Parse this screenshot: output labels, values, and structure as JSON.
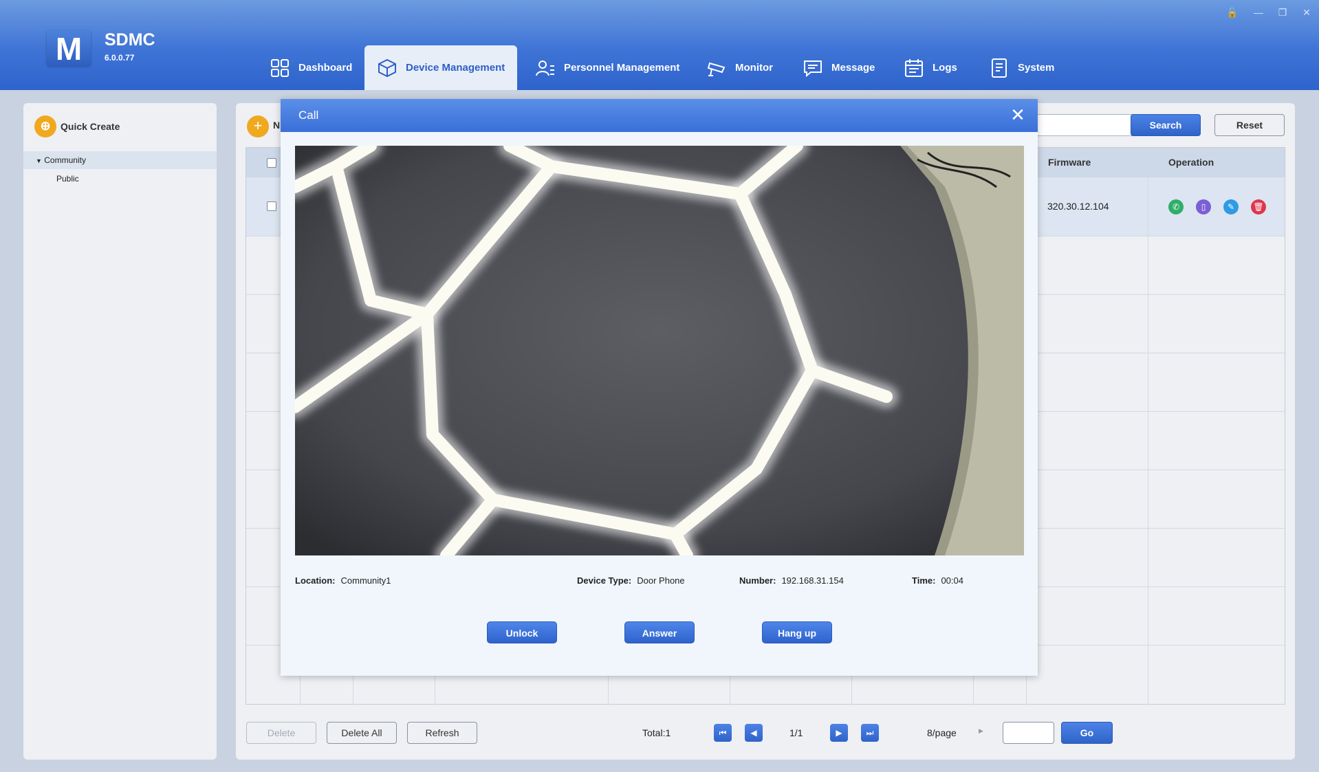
{
  "app": {
    "logo_letter": "M",
    "name": "SDMC",
    "version": "6.0.0.77"
  },
  "window_controls": {
    "lock": "🔓",
    "minimize": "—",
    "restore": "❐",
    "close": "✕"
  },
  "nav": [
    {
      "label": "Dashboard",
      "icon": "dashboard-icon"
    },
    {
      "label": "Device Management",
      "icon": "device-icon",
      "active": true
    },
    {
      "label": "Personnel Management",
      "icon": "personnel-icon"
    },
    {
      "label": "Monitor",
      "icon": "camera-icon"
    },
    {
      "label": "Message",
      "icon": "message-icon"
    },
    {
      "label": "Logs",
      "icon": "calendar-icon"
    },
    {
      "label": "System",
      "icon": "document-icon"
    }
  ],
  "sidebar": {
    "quick_create": "Quick Create",
    "tree": [
      {
        "label": "Community",
        "expanded": true
      },
      {
        "label": "Public"
      }
    ]
  },
  "main": {
    "add_label": "N",
    "search_label": "Search",
    "reset_label": "Reset",
    "columns": {
      "firmware": "Firmware",
      "operation": "Operation"
    },
    "row": {
      "firmware": "320.30.12.104"
    },
    "footer": {
      "delete": "Delete",
      "delete_all": "Delete All",
      "refresh": "Refresh",
      "total": "Total:1",
      "page": "1/1",
      "per_page": "8/page",
      "go": "Go"
    }
  },
  "dialog": {
    "title": "Call",
    "location_label": "Location:",
    "location": "Community1",
    "device_type_label": "Device Type:",
    "device_type": "Door Phone",
    "number_label": "Number:",
    "number": "192.168.31.154",
    "time_label": "Time:",
    "time": "00:04",
    "buttons": {
      "unlock": "Unlock",
      "answer": "Answer",
      "hangup": "Hang up"
    }
  },
  "colors": {
    "accent": "#3a6fd8",
    "call": "#2fae6a",
    "unlock": "#7b5fd6",
    "edit": "#2d9be6",
    "delete": "#e0354b",
    "quick": "#f0a81e"
  }
}
